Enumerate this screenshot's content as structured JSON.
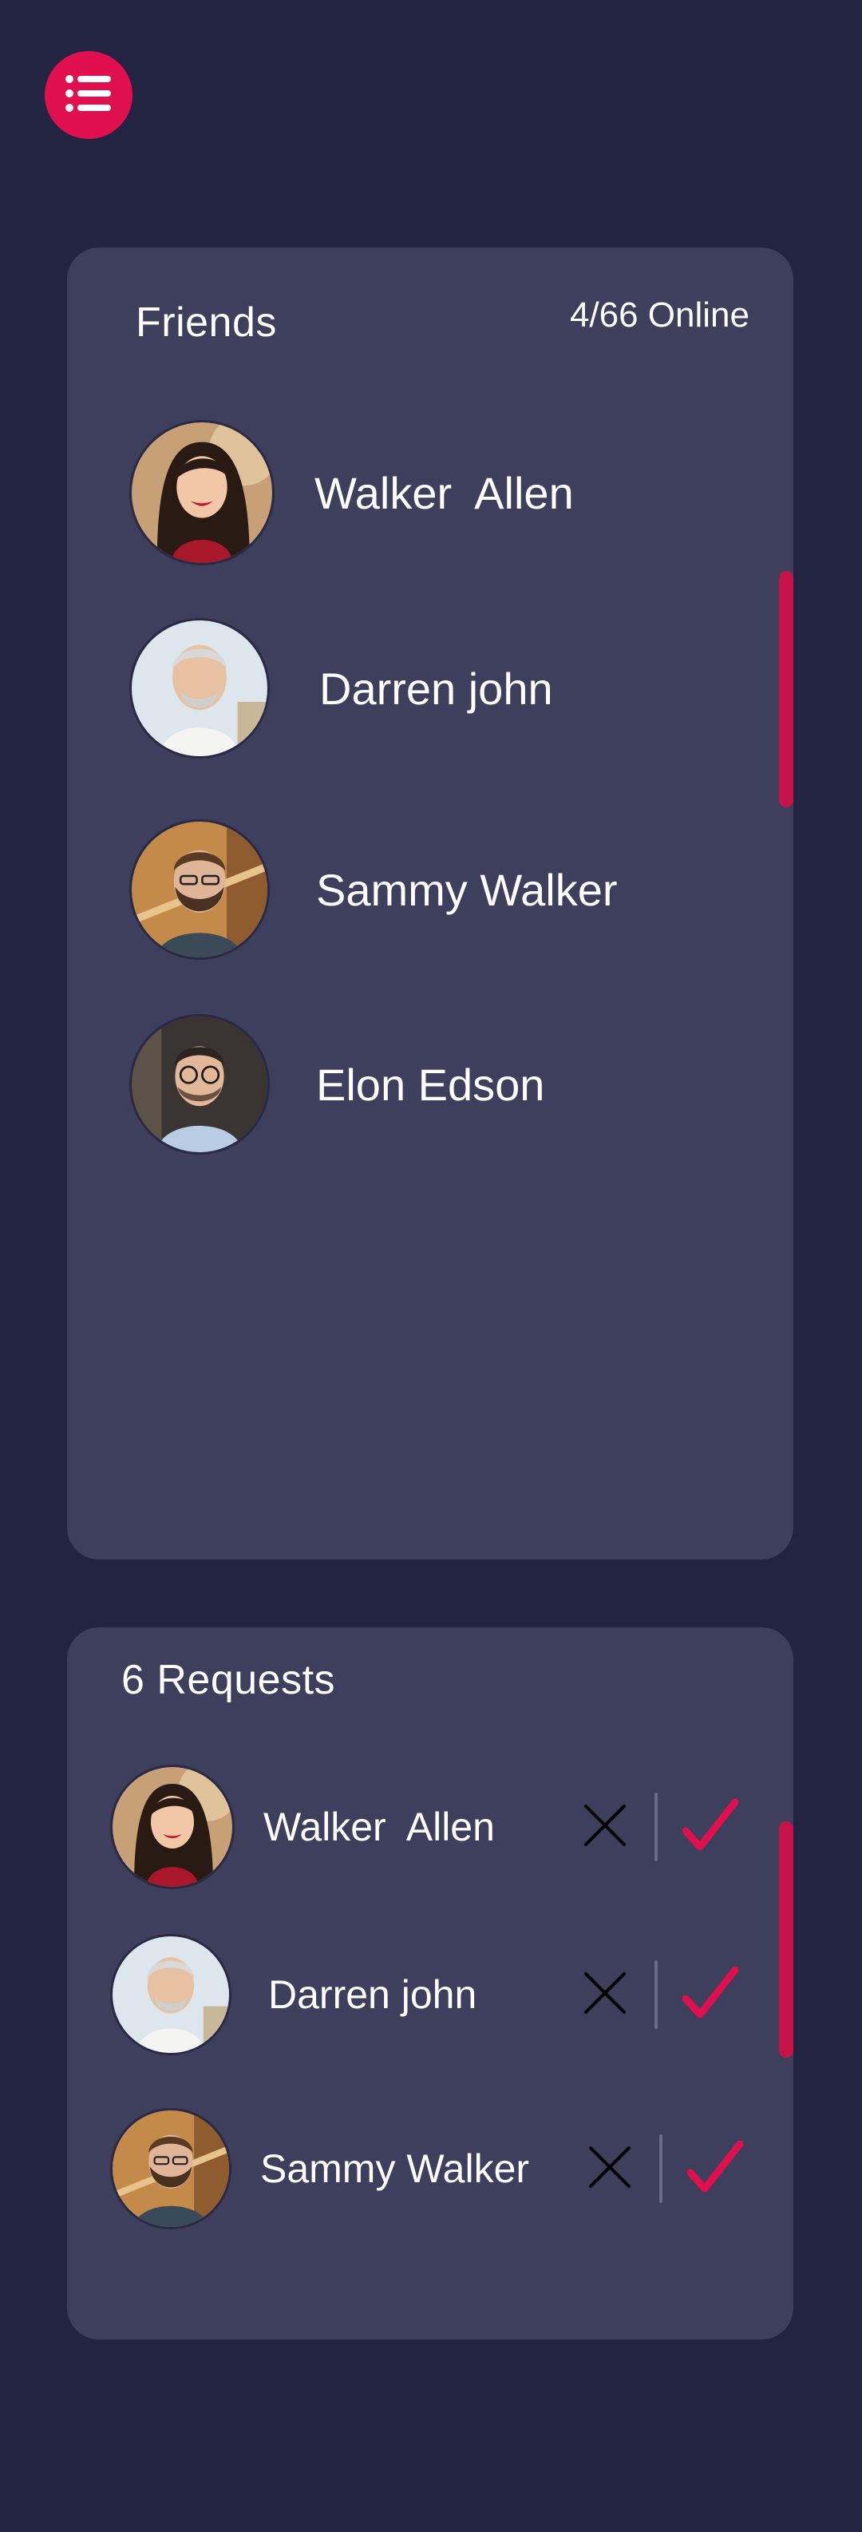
{
  "menu": {
    "icon": "list-menu-icon"
  },
  "friends": {
    "title": "Friends",
    "online": "4/66 Online",
    "items": [
      {
        "name": "Walker  Allen",
        "avatar": "woman-avatar"
      },
      {
        "name": "Darren john",
        "avatar": "older-man-avatar"
      },
      {
        "name": "Sammy Walker",
        "avatar": "bearded-man-avatar"
      },
      {
        "name": "Elon Edson",
        "avatar": "man-glasses-avatar"
      }
    ]
  },
  "requests": {
    "title": "6 Requests",
    "items": [
      {
        "name": "Walker  Allen",
        "avatar": "woman-avatar"
      },
      {
        "name": "Darren john",
        "avatar": "older-man-avatar"
      },
      {
        "name": "Sammy Walker",
        "avatar": "bearded-man-avatar"
      }
    ]
  },
  "colors": {
    "background": "#232441",
    "panel": "#3e3e5d",
    "accent": "#e0104f",
    "text": "#ffffff"
  }
}
